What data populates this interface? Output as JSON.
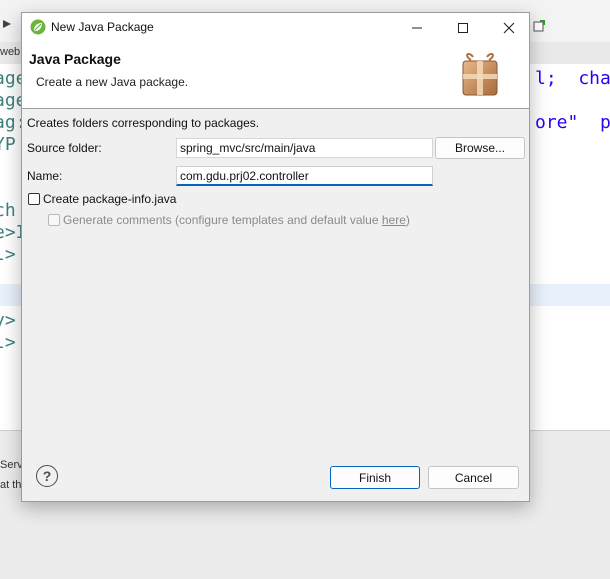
{
  "background": {
    "tab_label": "web",
    "code_lines": [
      {
        "left": "age",
        "right": "l;  char"
      },
      {
        "left": "age",
        "right": ""
      },
      {
        "left": "ag:",
        "right": "ore\"  pr"
      },
      {
        "left": "YP",
        "right": ""
      },
      {
        "left": "",
        "right": ""
      },
      {
        "left": "",
        "right": ""
      },
      {
        "left": "ch",
        "right": ""
      },
      {
        "left": "e>I",
        "right": ""
      },
      {
        "left": "l>",
        "right": ""
      },
      {
        "left": "",
        "right": ""
      },
      {
        "left": "",
        "right": ""
      },
      {
        "left": "y>",
        "right": ""
      },
      {
        "left": "l>",
        "right": ""
      }
    ],
    "bottom_tab": "Serve",
    "bottom_text": "at th"
  },
  "dialog": {
    "title": "New Java Package",
    "banner_title": "Java Package",
    "banner_message": "Create a new Java package.",
    "description": "Creates folders corresponding to packages.",
    "source_folder_label": "Source folder:",
    "source_folder_value": "spring_mvc/src/main/java",
    "browse_label": "Browse...",
    "name_label": "Name:",
    "name_value": "com.gdu.prj02.controller",
    "create_info_label": "Create package-info.java",
    "generate_comments_label": "Generate comments (configure templates and default value ",
    "generate_comments_link": "here",
    "generate_comments_suffix": ")",
    "help_symbol": "?",
    "finish_label": "Finish",
    "cancel_label": "Cancel"
  },
  "colors": {
    "accent": "#0067c0",
    "dialog_bg": "#f0f0f0",
    "banner_bg": "#ffffff"
  }
}
